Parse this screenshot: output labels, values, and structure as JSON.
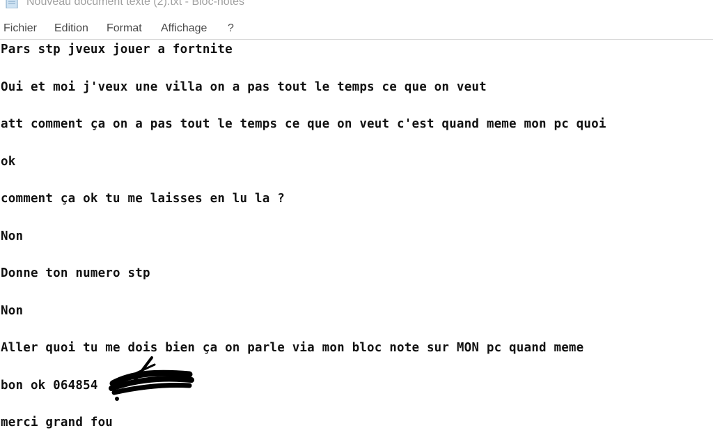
{
  "window": {
    "title": "Nouveau document texte (2).txt - Bloc-notes",
    "icon": "notepad-icon"
  },
  "menubar": {
    "items": [
      {
        "label": "Fichier"
      },
      {
        "label": "Edition"
      },
      {
        "label": "Format"
      },
      {
        "label": "Affichage"
      },
      {
        "label": "?"
      }
    ]
  },
  "editor": {
    "lines": [
      "Pars stp jveux jouer a fortnite",
      "Oui et moi j'veux une villa on a pas tout le temps ce que on veut",
      "att comment ça on a pas tout le temps ce que on veut c'est quand meme mon pc quoi",
      "ok",
      "comment ça ok tu me laisses en lu la ?",
      "Non",
      "Donne ton numero stp",
      "Non",
      "Aller quoi tu me dois bien ça on parle via mon bloc note sur MON pc quand meme",
      "bon ok 064854",
      "merci grand fou"
    ]
  },
  "colors": {
    "text": "#111111",
    "title_text": "#a0a0a0",
    "menu_text": "#4a4a4a",
    "redaction": "#000000"
  }
}
